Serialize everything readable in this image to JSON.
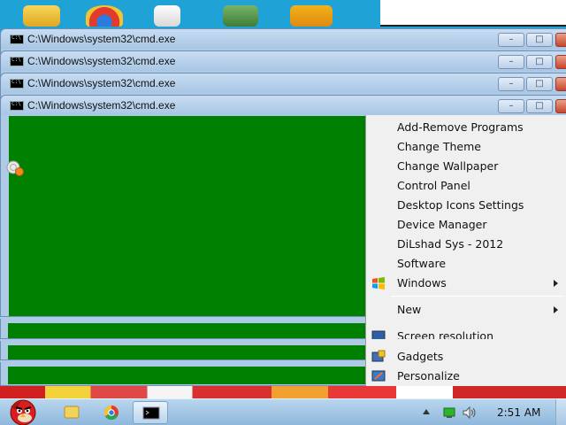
{
  "window_title": "C:\\Windows\\system32\\cmd.exe",
  "windows": [
    {
      "title": "C:\\Windows\\system32\\cmd.exe"
    },
    {
      "title": "C:\\Windows\\system32\\cmd.exe"
    },
    {
      "title": "C:\\Windows\\system32\\cmd.exe"
    },
    {
      "title": "C:\\Windows\\system32\\cmd.exe"
    }
  ],
  "window_buttons": {
    "minimize": "–",
    "maximize": "□",
    "close": "✕"
  },
  "context_menu": {
    "items": [
      {
        "label": "Add-Remove Programs",
        "icon": "",
        "submenu": false
      },
      {
        "label": "Change Theme",
        "icon": "",
        "submenu": false
      },
      {
        "label": "Change Wallpaper",
        "icon": "",
        "submenu": false
      },
      {
        "label": "Control Panel",
        "icon": "",
        "submenu": false
      },
      {
        "label": "Desktop Icons Settings",
        "icon": "",
        "submenu": false
      },
      {
        "label": "Device Manager",
        "icon": "",
        "submenu": false
      },
      {
        "label": "DiLshad Sys - 2012",
        "icon": "",
        "submenu": false
      },
      {
        "label": "Software",
        "icon": "",
        "submenu": false
      },
      {
        "label": "Windows",
        "icon": "windows-flag-icon",
        "submenu": true
      },
      {
        "label": "New",
        "icon": "",
        "submenu": true
      },
      {
        "label": "Screen resolution",
        "icon": "screen-icon",
        "submenu": false
      },
      {
        "label": "Gadgets",
        "icon": "gadgets-icon",
        "submenu": false
      },
      {
        "label": "Personalize",
        "icon": "personalize-icon",
        "submenu": false
      }
    ]
  },
  "taskbar": {
    "clock": "2:51 AM",
    "pinned": [
      "file-explorer-icon",
      "chrome-icon",
      "cmd-icon"
    ]
  },
  "colors": {
    "desktop": "#1fa2d6",
    "console_background": "#008000",
    "menu_background": "#f0f0f0",
    "titlebar": "#aecbe6"
  }
}
